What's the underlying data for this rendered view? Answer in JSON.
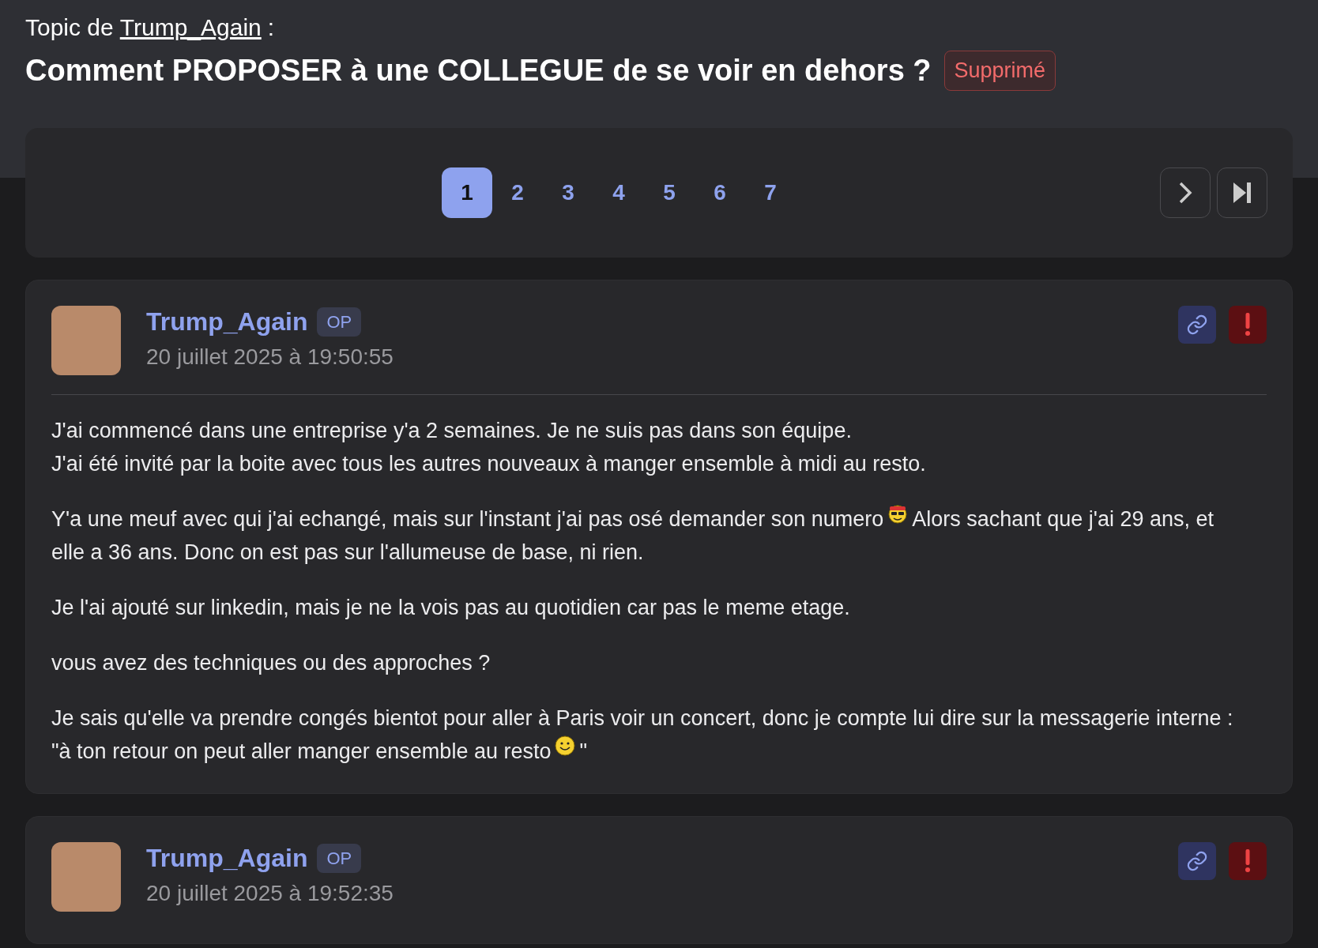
{
  "topic": {
    "prefix": "Topic de",
    "author": "Trump_Again",
    "suffix": ":",
    "title": "Comment PROPOSER à une COLLEGUE de se voir en dehors ?",
    "badge": "Supprimé"
  },
  "pagination": {
    "pages": [
      {
        "label": "1",
        "selected": true
      },
      {
        "label": "2",
        "selected": false
      },
      {
        "label": "3",
        "selected": false
      },
      {
        "label": "4",
        "selected": false
      },
      {
        "label": "5",
        "selected": false
      },
      {
        "label": "6",
        "selected": false
      },
      {
        "label": "7",
        "selected": false
      }
    ]
  },
  "posts": [
    {
      "author": "Trump_Again",
      "badge": "OP",
      "date": "20 juillet 2025 à 19:50:55",
      "paragraphs": [
        [
          {
            "kind": "text",
            "text": "J'ai commencé dans une entreprise y'a 2 semaines. Je ne suis pas dans son équipe."
          },
          {
            "kind": "break"
          },
          {
            "kind": "text",
            "text": "J'ai été invité par la boite avec tous les autres nouveaux à manger ensemble à midi au resto."
          }
        ],
        [
          {
            "kind": "text",
            "text": "Y'a une meuf avec qui j'ai echangé, mais sur l'instant j'ai pas osé demander son numero"
          },
          {
            "kind": "cool"
          },
          {
            "kind": "text",
            "text": "Alors sachant que j'ai 29 ans, et elle a 36 ans. Donc on est pas sur l'allumeuse de base, ni rien."
          }
        ],
        [
          {
            "kind": "text",
            "text": "Je l'ai ajouté sur linkedin, mais je ne la vois pas au quotidien car pas le meme etage."
          }
        ],
        [
          {
            "kind": "text",
            "text": "vous avez des techniques ou des approches ?"
          }
        ],
        [
          {
            "kind": "text",
            "text": "Je sais qu'elle va prendre congés bientot pour aller à Paris voir un concert, donc je compte lui dire sur la messagerie interne : \"à ton retour on peut aller manger ensemble au resto"
          },
          {
            "kind": "smile"
          },
          {
            "kind": "text",
            "text": "\""
          }
        ]
      ]
    },
    {
      "author": "Trump_Again",
      "badge": "OP",
      "date": "20 juillet 2025 à 19:52:35"
    }
  ]
}
